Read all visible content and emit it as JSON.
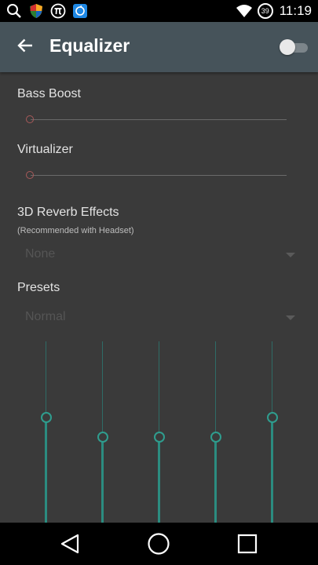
{
  "status_bar": {
    "time": "11:19",
    "battery_level": "39",
    "icons": [
      "search-icon",
      "shield-icon",
      "pi-icon",
      "sync-icon",
      "wifi-icon",
      "battery-icon"
    ]
  },
  "toolbar": {
    "title": "Equalizer",
    "toggle_on": false,
    "back_icon": "arrow-back-icon"
  },
  "bass_boost": {
    "label": "Bass Boost",
    "level": 0
  },
  "virtualizer": {
    "label": "Virtualizer",
    "level": 0
  },
  "reverb": {
    "label": "3D Reverb Effects",
    "hint": "(Recommended with Headset)",
    "selected": "None"
  },
  "presets": {
    "label": "Presets",
    "selected": "Normal"
  },
  "equalizer_bands": [
    {
      "level": 0.58
    },
    {
      "level": 0.47
    },
    {
      "level": 0.47
    },
    {
      "level": 0.47
    },
    {
      "level": 0.58
    }
  ],
  "colors": {
    "toolbar": "#46535a",
    "background": "#3a3a3a",
    "accent": "#2f9d8e",
    "slider_knob": "#a85a5a"
  },
  "nav_bar": {
    "icons": [
      "back-triangle-icon",
      "home-circle-icon",
      "recents-square-icon"
    ]
  }
}
